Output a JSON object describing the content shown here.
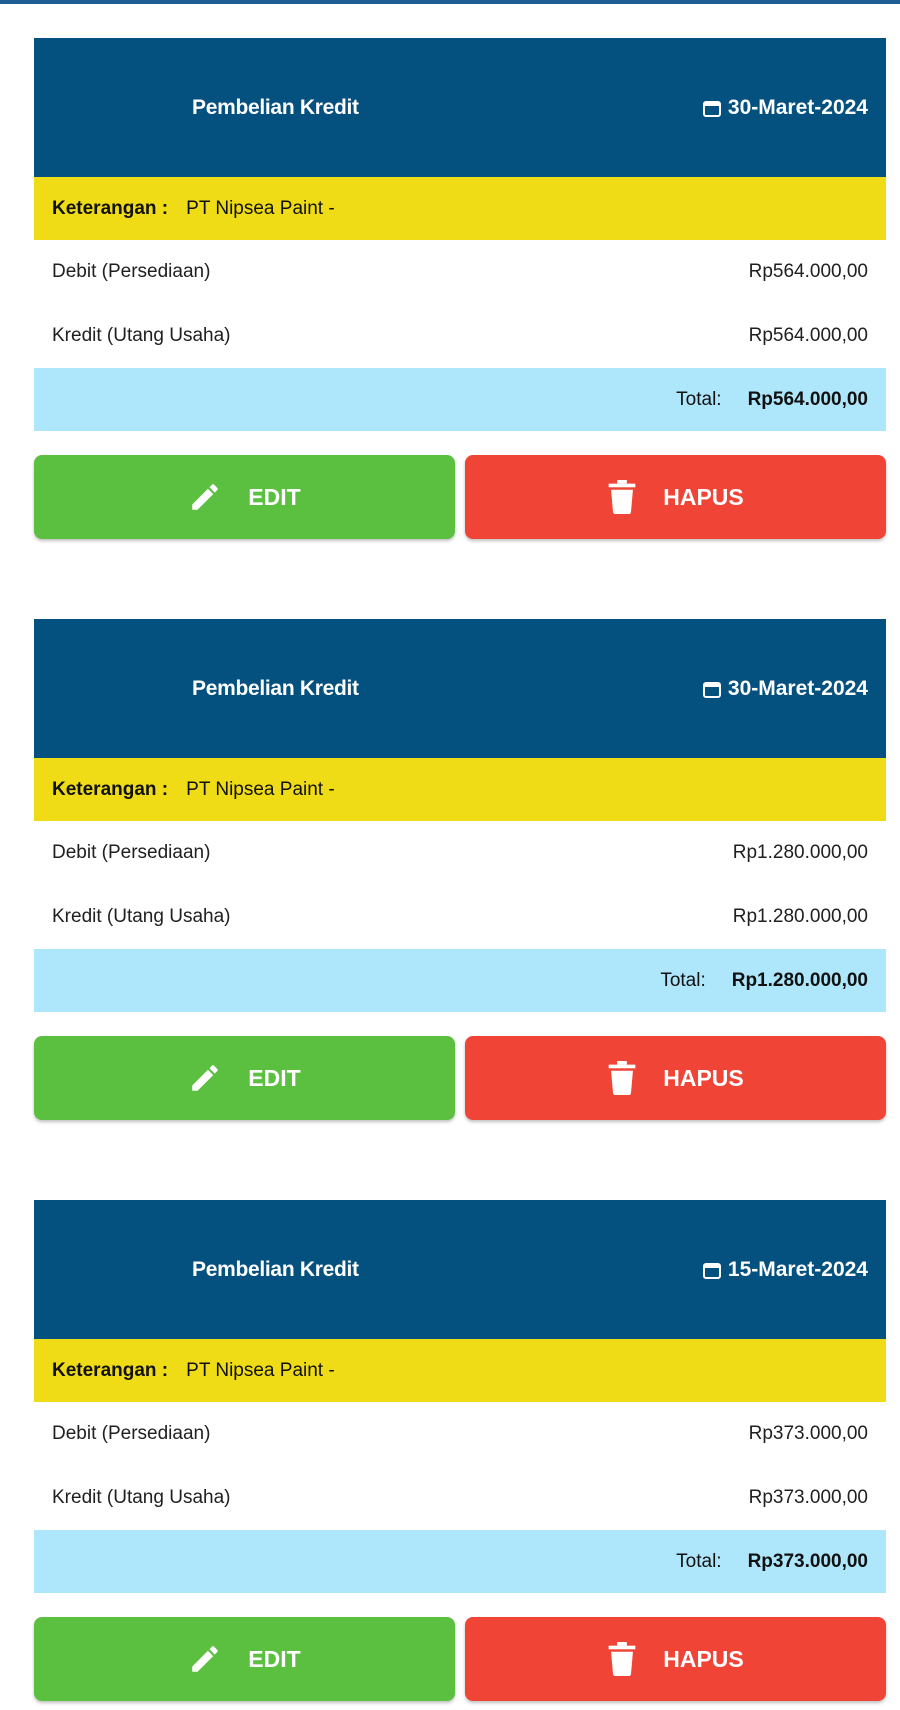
{
  "colors": {
    "header_bg": "#04507f",
    "note_bg": "#efdc17",
    "total_bg": "#aee6fb",
    "edit_bg": "#5bbf3f",
    "delete_bg": "#f04437"
  },
  "entries": [
    {
      "type": "Pembelian Kredit",
      "date": "30-Maret-2024",
      "note_label": "Keterangan :",
      "note_value": "PT Nipsea Paint -",
      "debit_label": "Debit (Persediaan)",
      "debit_value": "Rp564.000,00",
      "credit_label": "Kredit (Utang Usaha)",
      "credit_value": "Rp564.000,00",
      "total_label": "Total:",
      "total_value": "Rp564.000,00",
      "edit_label": "EDIT",
      "delete_label": "HAPUS"
    },
    {
      "type": "Pembelian Kredit",
      "date": "30-Maret-2024",
      "note_label": "Keterangan :",
      "note_value": "PT Nipsea Paint -",
      "debit_label": "Debit (Persediaan)",
      "debit_value": "Rp1.280.000,00",
      "credit_label": "Kredit (Utang Usaha)",
      "credit_value": "Rp1.280.000,00",
      "total_label": "Total:",
      "total_value": "Rp1.280.000,00",
      "edit_label": "EDIT",
      "delete_label": "HAPUS"
    },
    {
      "type": "Pembelian Kredit",
      "date": "15-Maret-2024",
      "note_label": "Keterangan :",
      "note_value": "PT Nipsea Paint -",
      "debit_label": "Debit (Persediaan)",
      "debit_value": "Rp373.000,00",
      "credit_label": "Kredit (Utang Usaha)",
      "credit_value": "Rp373.000,00",
      "total_label": "Total:",
      "total_value": "Rp373.000,00",
      "edit_label": "EDIT",
      "delete_label": "HAPUS"
    }
  ],
  "icons": {
    "date": "calendar-icon",
    "edit": "pencil-icon",
    "delete": "trash-icon"
  }
}
